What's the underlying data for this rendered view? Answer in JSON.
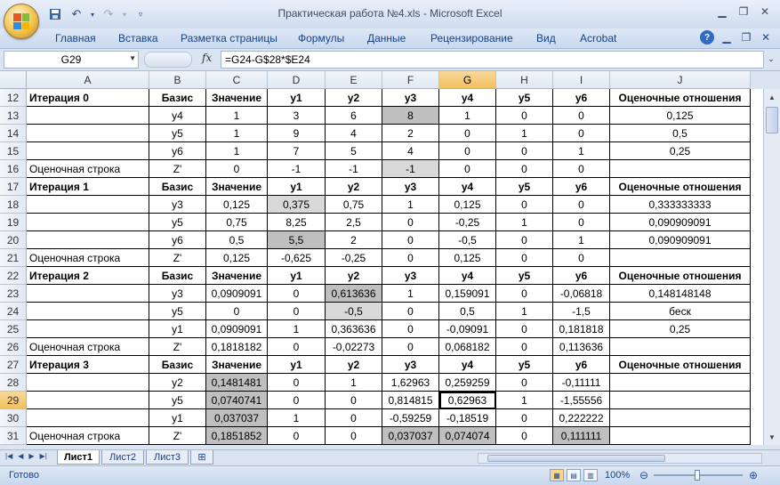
{
  "window": {
    "title": "Практическая работа №4.xls - Microsoft Excel",
    "minimize_icon": "minimize-icon",
    "maximize_icon": "restore-icon",
    "close_icon": "close-icon"
  },
  "ribbon": {
    "tabs": [
      "Главная",
      "Вставка",
      "Разметка страницы",
      "Формулы",
      "Данные",
      "Рецензирование",
      "Вид",
      "Acrobat"
    ]
  },
  "formula_bar": {
    "name_box": "G29",
    "fx_label": "fx",
    "formula": "=G24-G$28*$E24"
  },
  "columns": [
    "A",
    "B",
    "C",
    "D",
    "E",
    "F",
    "G",
    "H",
    "I",
    "J"
  ],
  "selected_column": "G",
  "selected_row": 29,
  "rows": [
    {
      "n": 12,
      "cells": [
        "Итерация 0",
        "Базис",
        "Значение",
        "y1",
        "y2",
        "y3",
        "y4",
        "y5",
        "y6",
        "Оценочные отношения"
      ],
      "header": true
    },
    {
      "n": 13,
      "cells": [
        "",
        "y4",
        "1",
        "3",
        "6",
        "8",
        "1",
        "0",
        "0",
        "0,125"
      ]
    },
    {
      "n": 14,
      "cells": [
        "",
        "y5",
        "1",
        "9",
        "4",
        "2",
        "0",
        "1",
        "0",
        "0,5"
      ]
    },
    {
      "n": 15,
      "cells": [
        "",
        "y6",
        "1",
        "7",
        "5",
        "4",
        "0",
        "0",
        "1",
        "0,25"
      ]
    },
    {
      "n": 16,
      "cells": [
        "Оценочная строка",
        "Z'",
        "0",
        "-1",
        "-1",
        "-1",
        "0",
        "0",
        "0",
        ""
      ]
    },
    {
      "n": 17,
      "cells": [
        "Итерация 1",
        "Базис",
        "Значение",
        "y1",
        "y2",
        "y3",
        "y4",
        "y5",
        "y6",
        "Оценочные отношения"
      ],
      "header": true
    },
    {
      "n": 18,
      "cells": [
        "",
        "y3",
        "0,125",
        "0,375",
        "0,75",
        "1",
        "0,125",
        "0",
        "0",
        "0,333333333"
      ]
    },
    {
      "n": 19,
      "cells": [
        "",
        "y5",
        "0,75",
        "8,25",
        "2,5",
        "0",
        "-0,25",
        "1",
        "0",
        "0,090909091"
      ]
    },
    {
      "n": 20,
      "cells": [
        "",
        "y6",
        "0,5",
        "5,5",
        "2",
        "0",
        "-0,5",
        "0",
        "1",
        "0,090909091"
      ]
    },
    {
      "n": 21,
      "cells": [
        "Оценочная строка",
        "Z'",
        "0,125",
        "-0,625",
        "-0,25",
        "0",
        "0,125",
        "0",
        "0",
        ""
      ]
    },
    {
      "n": 22,
      "cells": [
        "Итерация 2",
        "Базис",
        "Значение",
        "y1",
        "y2",
        "y3",
        "y4",
        "y5",
        "y6",
        "Оценочные отношения"
      ],
      "header": true
    },
    {
      "n": 23,
      "cells": [
        "",
        "y3",
        "0,0909091",
        "0",
        "0,613636",
        "1",
        "0,159091",
        "0",
        "-0,06818",
        "0,148148148"
      ]
    },
    {
      "n": 24,
      "cells": [
        "",
        "y5",
        "0",
        "0",
        "-0,5",
        "0",
        "0,5",
        "1",
        "-1,5",
        "беск"
      ]
    },
    {
      "n": 25,
      "cells": [
        "",
        "y1",
        "0,0909091",
        "1",
        "0,363636",
        "0",
        "-0,09091",
        "0",
        "0,181818",
        "0,25"
      ]
    },
    {
      "n": 26,
      "cells": [
        "Оценочная строка",
        "Z'",
        "0,1818182",
        "0",
        "-0,02273",
        "0",
        "0,068182",
        "0",
        "0,113636",
        ""
      ]
    },
    {
      "n": 27,
      "cells": [
        "Итерация 3",
        "Базис",
        "Значение",
        "y1",
        "y2",
        "y3",
        "y4",
        "y5",
        "y6",
        "Оценочные отношения"
      ],
      "header": true
    },
    {
      "n": 28,
      "cells": [
        "",
        "y2",
        "0,1481481",
        "0",
        "1",
        "1,62963",
        "0,259259",
        "0",
        "-0,11111",
        ""
      ]
    },
    {
      "n": 29,
      "cells": [
        "",
        "y5",
        "0,0740741",
        "0",
        "0",
        "0,814815",
        "0,62963",
        "1",
        "-1,55556",
        ""
      ]
    },
    {
      "n": 30,
      "cells": [
        "",
        "y1",
        "0,037037",
        "1",
        "0",
        "-0,59259",
        "-0,18519",
        "0",
        "0,222222",
        ""
      ]
    },
    {
      "n": 31,
      "cells": [
        "Оценочная строка",
        "Z'",
        "0,1851852",
        "0",
        "0",
        "0,037037",
        "0,074074",
        "0",
        "0,111111",
        ""
      ]
    }
  ],
  "sheets": [
    "Лист1",
    "Лист2",
    "Лист3"
  ],
  "active_sheet": "Лист1",
  "status": {
    "ready": "Готово",
    "zoom": "100%"
  },
  "colors": {
    "gray_light": "#d9d9d9",
    "gray_dark": "#bfbfbf",
    "selection": "#f8d68c"
  }
}
